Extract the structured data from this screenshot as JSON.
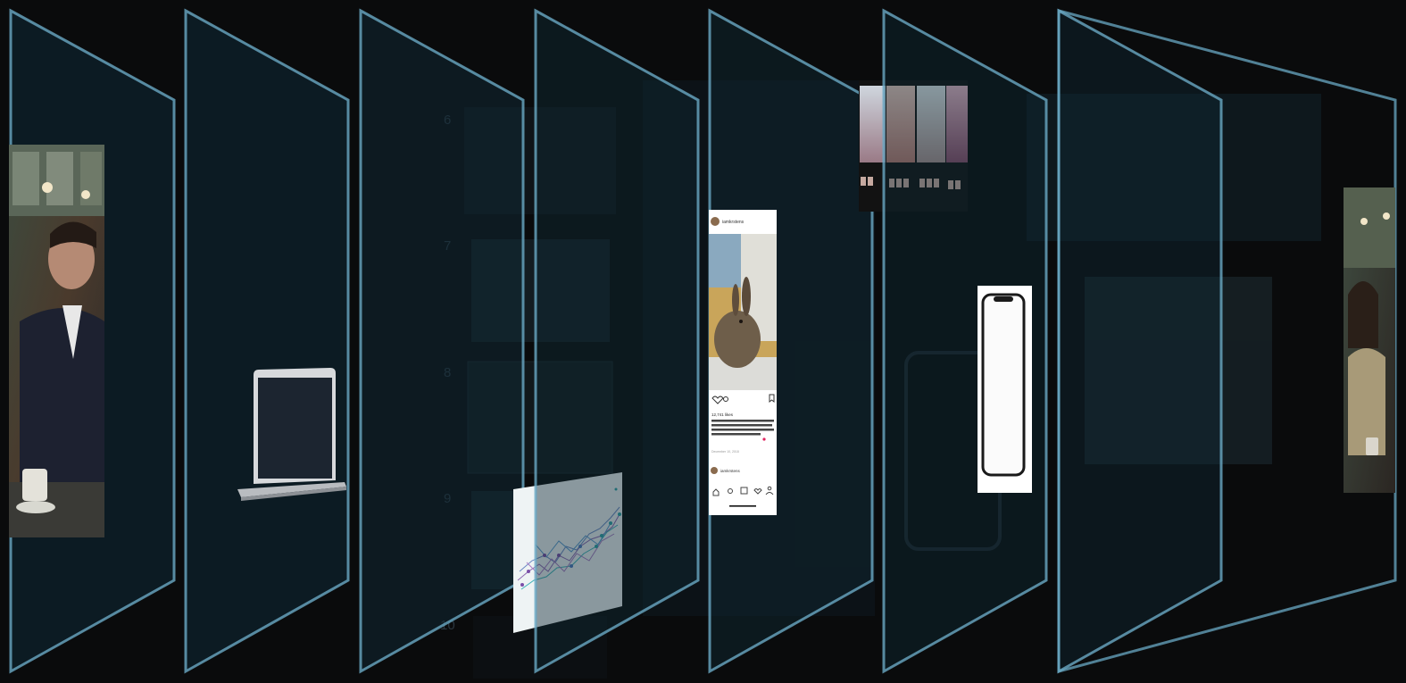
{
  "scene": {
    "background": "#0a0b0c",
    "panel_fill": "#0f2a36",
    "panel_stroke": "#6aa9c4",
    "layer_count": 7
  },
  "ghost_step_numbers": [
    "6",
    "7",
    "8",
    "9",
    "10"
  ],
  "instagram_post": {
    "username": "iamkrstens",
    "likes": "12,741 likes",
    "caption": "iamkrstens: Wow my bunny ... cute pet ...",
    "date": "December 10, 2018",
    "comment_user": "iamkrstens"
  },
  "laptop": {
    "name": "laptop-mockup"
  },
  "phone": {
    "name": "phone-mockup"
  },
  "icons": [
    "heart-icon",
    "comment-icon",
    "bookmark-icon",
    "home-icon",
    "search-icon",
    "add-icon",
    "activity-icon",
    "profile-icon"
  ]
}
